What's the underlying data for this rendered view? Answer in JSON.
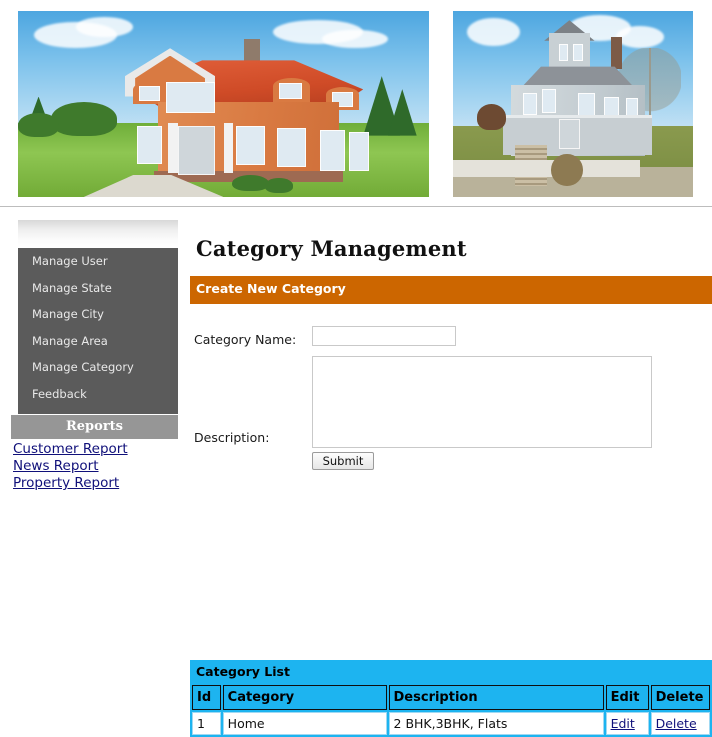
{
  "banner": {
    "images": [
      {
        "alt": "orange-stucco-house-photo"
      },
      {
        "alt": "grey-victorian-house-photo"
      }
    ]
  },
  "sidebar": {
    "items": [
      {
        "label": "Manage User"
      },
      {
        "label": "Manage State"
      },
      {
        "label": "Manage City"
      },
      {
        "label": "Manage Area"
      },
      {
        "label": "Manage Category"
      },
      {
        "label": "Feedback"
      }
    ],
    "reports_heading": "Reports",
    "report_links": [
      {
        "label": "Customer Report"
      },
      {
        "label": "News Report"
      },
      {
        "label": "Property Report"
      }
    ]
  },
  "main": {
    "page_title": "Category Management",
    "create_section_title": "Create New Category",
    "form": {
      "category_name_label": "Category Name:",
      "category_name_value": "",
      "category_name_placeholder": "",
      "description_label": "Description:",
      "description_value": "",
      "description_placeholder": "",
      "submit_label": "Submit"
    },
    "list": {
      "title": "Category List",
      "columns": [
        "Id",
        "Category",
        "Description",
        "Edit",
        "Delete"
      ],
      "rows": [
        {
          "id": "1",
          "category": "Home",
          "description": "2 BHK,3BHK, Flats",
          "edit": "Edit",
          "delete": "Delete"
        }
      ]
    }
  },
  "colors": {
    "accent_orange": "#cc6600",
    "accent_cyan": "#1db4f0",
    "sidebar_dark": "#5b5b5b",
    "reports_gray": "#969696",
    "link_navy": "#10107a"
  }
}
